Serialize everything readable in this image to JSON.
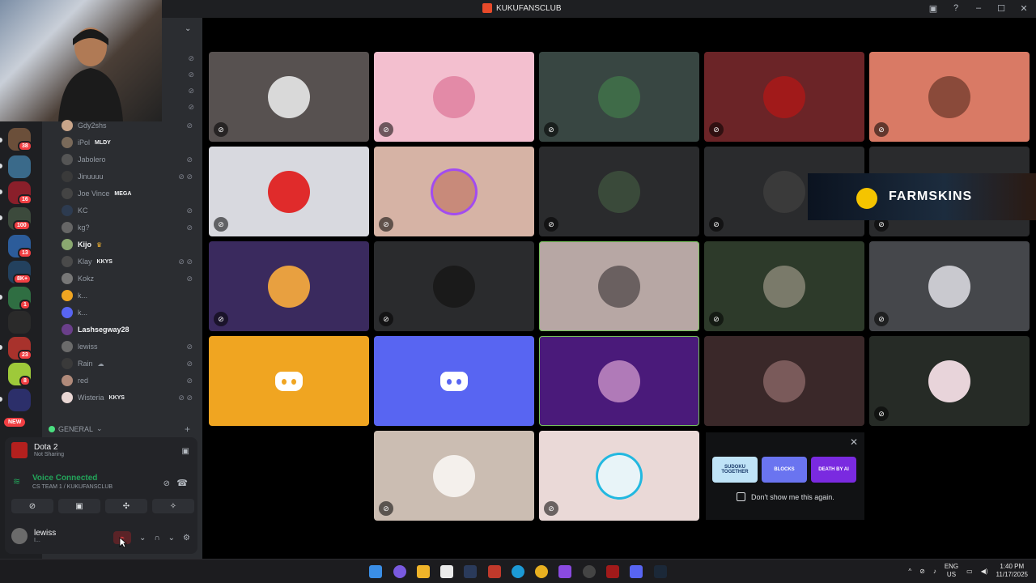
{
  "window": {
    "title": "KUKUFANSCLUB"
  },
  "servers": [
    {
      "badge": "38"
    },
    {
      "badge": ""
    },
    {
      "badge": "16"
    },
    {
      "badge": "100"
    },
    {
      "badge": "13"
    },
    {
      "badge": "8K+"
    },
    {
      "badge": "1"
    },
    {
      "badge": ""
    },
    {
      "badge": "23"
    },
    {
      "badge": "8"
    },
    {
      "badge": ""
    }
  ],
  "new_label": "NEW",
  "members": [
    {
      "name": "Gdy2shs",
      "tag": ""
    },
    {
      "name": "iPol",
      "tag": "MLDY"
    },
    {
      "name": "Jabolero",
      "tag": ""
    },
    {
      "name": "Jinuuuu",
      "tag": ""
    },
    {
      "name": "Joe Vince",
      "tag": "MEGA"
    },
    {
      "name": "KC",
      "tag": ""
    },
    {
      "name": "kg?",
      "tag": ""
    },
    {
      "name": "Kijo",
      "tag": ""
    },
    {
      "name": "Klay",
      "tag": "KKYS"
    },
    {
      "name": "Kokz",
      "tag": ""
    },
    {
      "name": "k...",
      "tag": ""
    },
    {
      "name": "k...",
      "tag": ""
    },
    {
      "name": "Lashsegway28",
      "tag": ""
    },
    {
      "name": "lewiss",
      "tag": ""
    },
    {
      "name": "Rain",
      "tag": ""
    },
    {
      "name": "red",
      "tag": ""
    },
    {
      "name": "Wisteria",
      "tag": "KKYS"
    }
  ],
  "channel_category": "GENERAL",
  "activity": {
    "game": "Dota 2",
    "status": "Not Sharing"
  },
  "voice": {
    "status": "Voice Connected",
    "channel": "CS TEAM 1 / KUKUFANSCLUB"
  },
  "user": {
    "name": "lewiss",
    "status": "I..."
  },
  "ad": {
    "brand": "FARMSKINS"
  },
  "popup": {
    "checkbox_label": "Don't show me this again.",
    "cards": [
      "SUDOKU TOGETHER",
      "BLOCKS",
      "DEATH BY AI"
    ]
  },
  "tray": {
    "lang1": "ENG",
    "lang2": "US",
    "time": "1:40 PM",
    "date": "11/17/2025"
  },
  "colors": {
    "accent": "#5865f2",
    "green": "#23a55a",
    "red": "#f23f43"
  }
}
